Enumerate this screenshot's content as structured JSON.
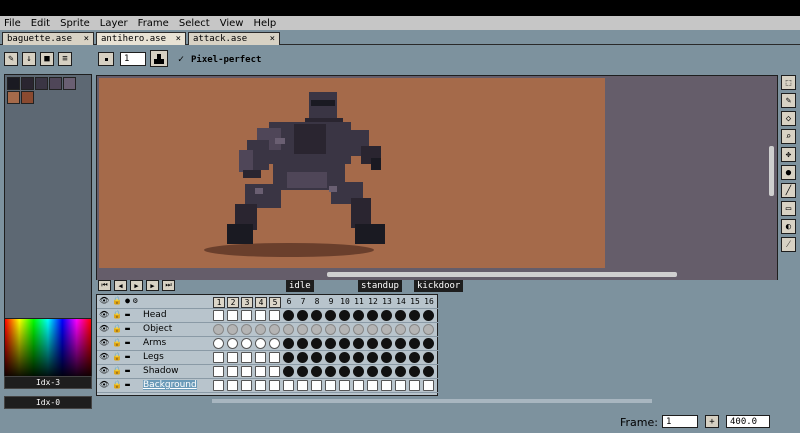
{
  "menu": [
    "File",
    "Edit",
    "Sprite",
    "Layer",
    "Frame",
    "Select",
    "View",
    "Help"
  ],
  "tabs": [
    {
      "label": "baguette.ase",
      "close": "×",
      "active": false
    },
    {
      "label": "antihero.ase",
      "close": "×",
      "active": true
    },
    {
      "label": "attack.ase",
      "close": "×",
      "active": false
    }
  ],
  "toolbar": {
    "brush_size": "1",
    "pixel_perfect_check": "✓",
    "pixel_perfect_label": "Pixel-perfect",
    "mode_buttons": [
      "✎",
      "↓",
      "■",
      "≡"
    ]
  },
  "palette": {
    "swatches": [
      "#1a1a22",
      "#2a2530",
      "#3a3544",
      "#4f4658",
      "#6a5f72",
      "#a56a4a",
      "#8a4a30"
    ]
  },
  "color_indices": {
    "foreground": "Idx-3",
    "background": "Idx-0"
  },
  "timeline": {
    "tags": [
      {
        "name": "idle"
      },
      {
        "name": "standup"
      },
      {
        "name": "kickdoor"
      }
    ],
    "frames": [
      "1",
      "2",
      "3",
      "4",
      "5",
      "6",
      "7",
      "8",
      "9",
      "10",
      "11",
      "12",
      "13",
      "14",
      "15",
      "16"
    ],
    "layers": [
      {
        "name": "Head",
        "cels": "filled"
      },
      {
        "name": "Object",
        "cels": "dim"
      },
      {
        "name": "Arms",
        "cels": "mixed"
      },
      {
        "name": "Legs",
        "cels": "filled"
      },
      {
        "name": "Shadow",
        "cels": "filled"
      },
      {
        "name": "Background",
        "cels": "empty"
      }
    ]
  },
  "status": {
    "frame_label": "Frame:",
    "frame_value": "1",
    "add_button": "+",
    "zoom": "400.0"
  },
  "colors": {
    "canvas_bg": "#a56a4a",
    "workspace": "#655d6a",
    "ui_bg": "#7d929e",
    "panel": "#d8d2c4"
  }
}
